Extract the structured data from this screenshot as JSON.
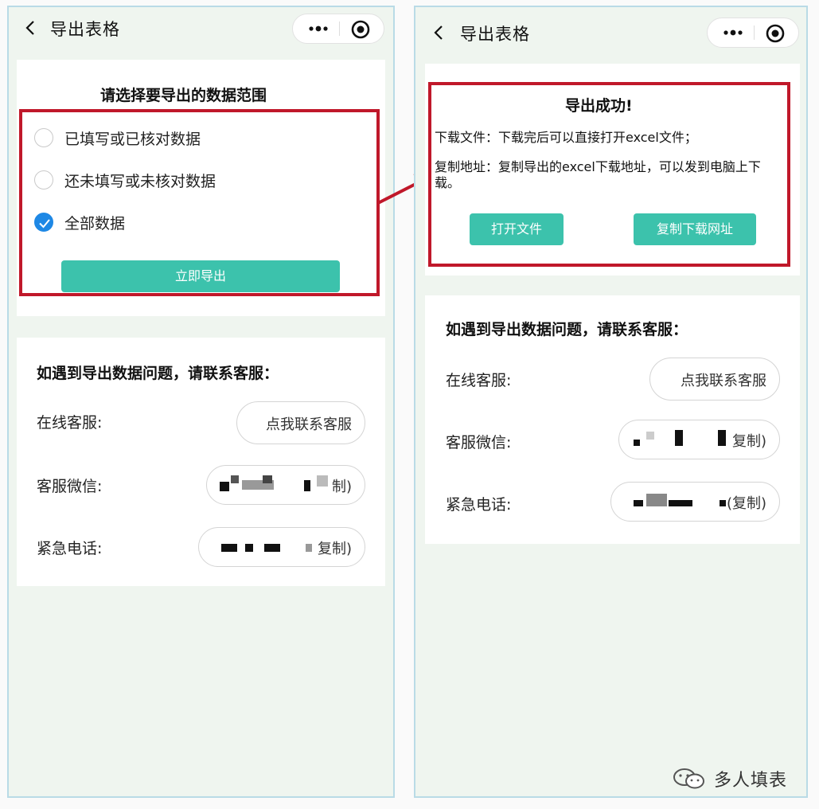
{
  "left_screen": {
    "nav": {
      "title": "导出表格"
    },
    "export_section": {
      "heading": "请选择要导出的数据范围",
      "options": [
        {
          "label": "已填写或已核对数据",
          "checked": false
        },
        {
          "label": "还未填写或未核对数据",
          "checked": false
        },
        {
          "label": "全部数据",
          "checked": true
        }
      ],
      "export_button": "立即导出"
    },
    "contact_section": {
      "heading": "如遇到导出数据问题，请联系客服：",
      "online_label": "在线客服:",
      "online_button": "点我联系客服",
      "wechat_label": "客服微信:",
      "wechat_copy": "制)",
      "phone_label": "紧急电话:",
      "phone_copy": "复制)"
    }
  },
  "right_screen": {
    "nav": {
      "title": "导出表格"
    },
    "success_section": {
      "title": "导出成功!",
      "line1": "下载文件：下载完后可以直接打开excel文件；",
      "line2": "复制地址：复制导出的excel下载地址，可以发到电脑上下载。",
      "open_button": "打开文件",
      "copy_button": "复制下载网址"
    },
    "contact_section": {
      "heading": "如遇到导出数据问题，请联系客服：",
      "online_label": "在线客服:",
      "online_button": "点我联系客服",
      "wechat_label": "客服微信:",
      "wechat_copy": "复制)",
      "phone_label": "紧急电话:",
      "phone_copy": "(复制)"
    }
  },
  "watermark": {
    "text": "多人填表"
  },
  "colors": {
    "accent_green": "#3cc2ac",
    "highlight_red": "#c0182a",
    "check_blue": "#1e88e5"
  },
  "icons": [
    "back-arrow",
    "more-dots",
    "target-circle",
    "check",
    "arrow-right",
    "wechat-logo"
  ]
}
